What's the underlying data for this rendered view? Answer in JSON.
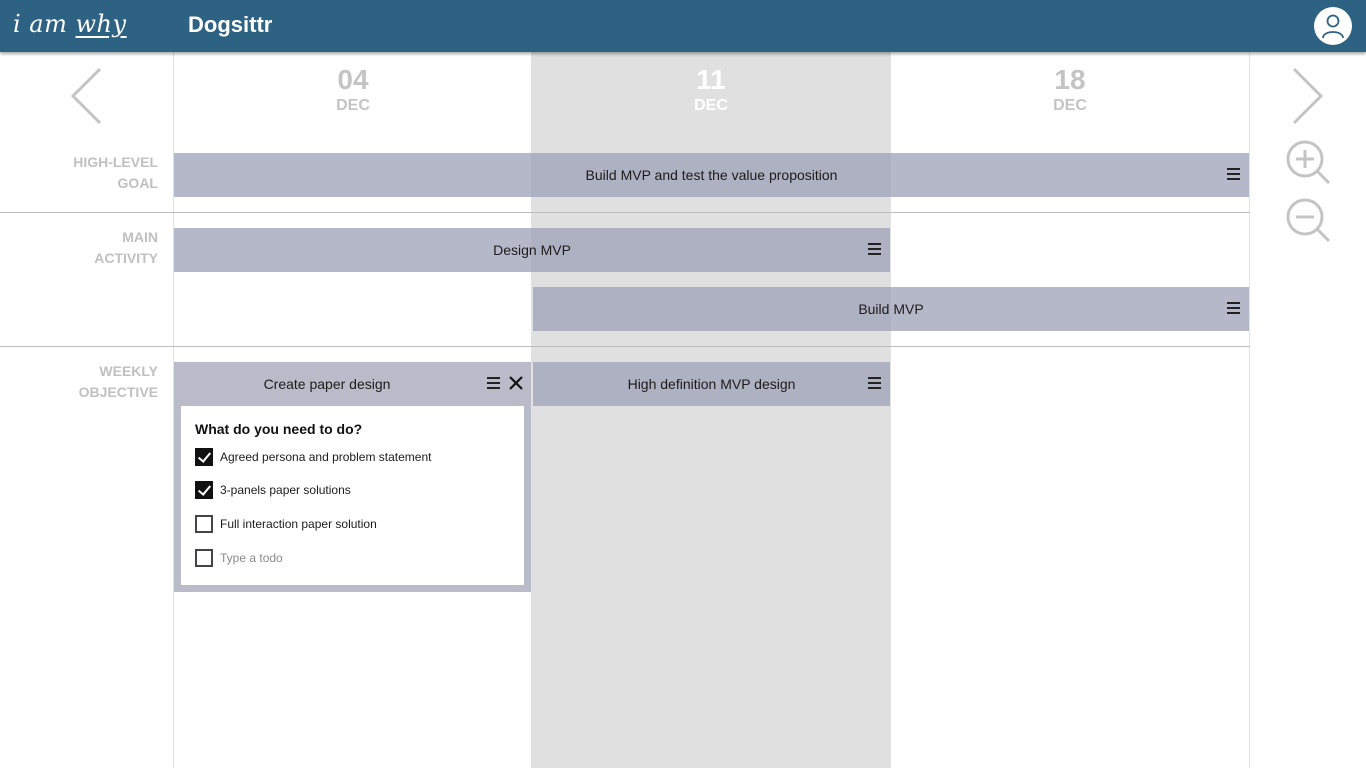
{
  "header": {
    "logo_prefix": "i am",
    "logo_word": "why",
    "project_title": "Dogsittr",
    "avatar_icon": "user-icon"
  },
  "colors": {
    "header_bg": "#2e6283",
    "bar_bg": "#a0a4b8",
    "current_week_bg": "#e0e0e0",
    "muted_text": "#c0c0c0"
  },
  "timeline": {
    "weeks": [
      {
        "day": "04",
        "month": "DEC"
      },
      {
        "day": "11",
        "month": "DEC",
        "current": true
      },
      {
        "day": "18",
        "month": "DEC"
      }
    ],
    "prev_icon": "chevron-left-icon",
    "next_icon": "chevron-right-icon",
    "zoom_in_icon": "zoom-in-icon",
    "zoom_out_icon": "zoom-out-icon"
  },
  "rows": {
    "high_level_goal": {
      "label_line1": "HIGH-LEVEL",
      "label_line2": "GOAL"
    },
    "main_activity": {
      "label_line1": "MAIN",
      "label_line2": "ACTIVITY"
    },
    "weekly_objective": {
      "label_line1": "WEEKLY",
      "label_line2": "OBJECTIVE"
    }
  },
  "goals": [
    {
      "title": "Build MVP and test the value proposition"
    }
  ],
  "activities": [
    {
      "title": "Design MVP"
    },
    {
      "title": "Build MVP"
    }
  ],
  "objectives": [
    {
      "title": "Create paper design",
      "expanded": true,
      "todo_question": "What do you need to do?",
      "todos": [
        {
          "text": "Agreed persona and problem statement",
          "done": true
        },
        {
          "text": "3-panels paper solutions",
          "done": true
        },
        {
          "text": "Full interaction paper solution",
          "done": false
        }
      ],
      "new_todo_placeholder": "Type a todo"
    },
    {
      "title": "High definition MVP design",
      "expanded": false
    }
  ]
}
